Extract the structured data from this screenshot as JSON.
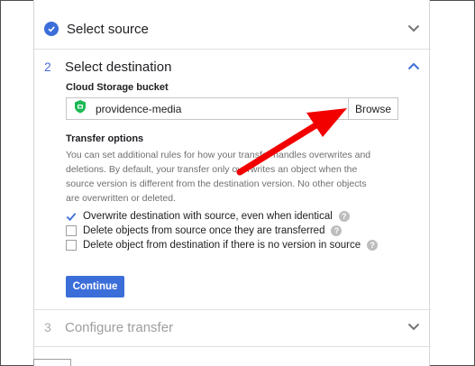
{
  "steps": {
    "source": {
      "title": "Select source"
    },
    "destination": {
      "number": "2",
      "title": "Select destination",
      "bucket_label": "Cloud Storage bucket",
      "bucket_value": "providence-media",
      "browse_label": "Browse",
      "options_label": "Transfer options",
      "options_desc_lines": [
        "You can set additional rules for how your transfer handles overwrites and",
        "deletions. By default, your transfer only overwrites an object when the",
        "source version is different from the destination version. No other objects",
        "are overwritten or deleted."
      ],
      "options": [
        {
          "label": "Overwrite destination with source, even when identical",
          "checked": true
        },
        {
          "label": "Delete objects from source once they are transferred",
          "checked": false
        },
        {
          "label": "Delete object from destination if there is no version in source",
          "checked": false
        }
      ],
      "continue_label": "Continue"
    },
    "configure": {
      "number": "3",
      "title": "Configure transfer"
    }
  },
  "colors": {
    "accent": "#3b6ed9",
    "annotation_arrow": "#f20000",
    "bucket_icon": "#1db954"
  },
  "icons": {
    "completed_step": "check-circle-icon",
    "collapse": "chevron-up-icon",
    "expand": "chevron-down-icon",
    "bucket": "bucket-icon",
    "help": "help-icon"
  }
}
